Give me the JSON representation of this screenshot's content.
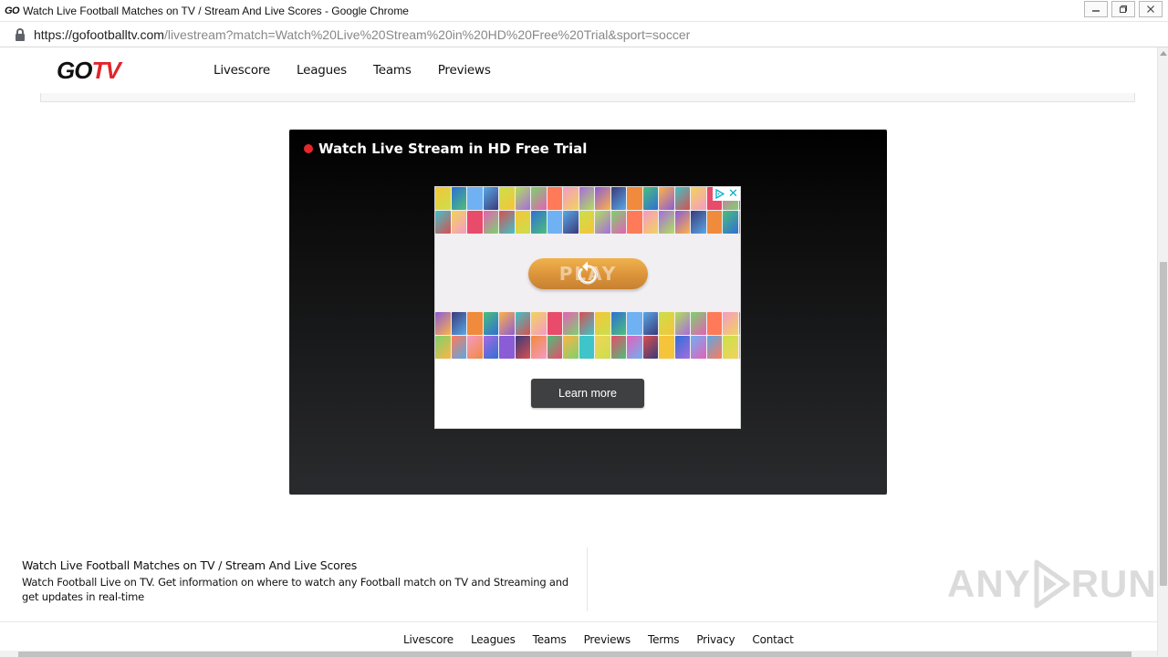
{
  "window": {
    "favicon_text": "GO",
    "title": "Watch Live Football Matches on TV / Stream And Live Scores - Google Chrome",
    "minimize_label": "▭",
    "restore_label": "❐",
    "close_label": "✕"
  },
  "address_bar": {
    "url_host": "https://gofootballtv.com",
    "url_path": "/livestream?match=Watch%20Live%20Stream%20in%20HD%20Free%20Trial&sport=soccer"
  },
  "site": {
    "logo_go": "GO",
    "logo_tv": "TV",
    "nav": [
      "Livescore",
      "Leagues",
      "Teams",
      "Previews"
    ]
  },
  "player": {
    "title": "Watch Live Stream in HD Free Trial",
    "live_color": "#e5262a"
  },
  "ad": {
    "play_label": "PLAY",
    "close_label": "✕",
    "learn_more": "Learn more",
    "accent": "#00aecd"
  },
  "footer": {
    "title": "Watch Live Football Matches on TV / Stream And Live Scores",
    "description": "Watch Football Live on TV. Get information on where to watch any Football match on TV and Streaming and get updates in real-time",
    "links": [
      "Livescore",
      "Leagues",
      "Teams",
      "Previews",
      "Terms",
      "Privacy",
      "Contact"
    ]
  },
  "watermark": {
    "left": "ANY",
    "right": "RUN"
  }
}
